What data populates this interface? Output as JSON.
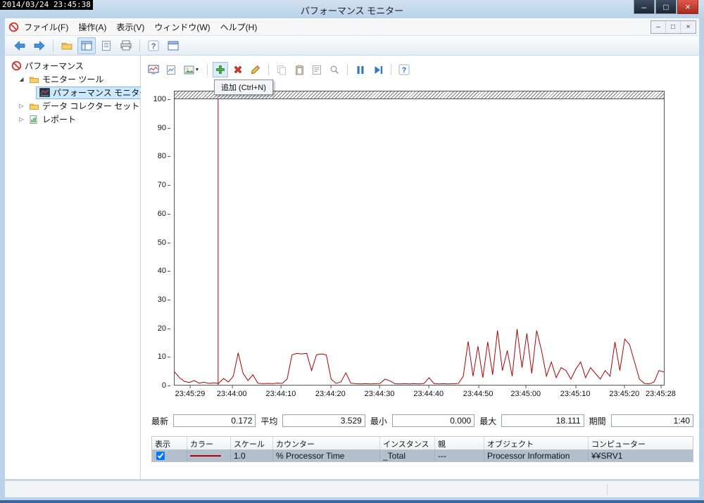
{
  "overlay": {
    "timestamp": "2014/03/24 23:45:38"
  },
  "window": {
    "title": "パフォーマンス モニター",
    "controls": {
      "minimize": "–",
      "maximize": "□",
      "close": "×"
    },
    "child_controls": [
      "–",
      "□",
      "×"
    ]
  },
  "menubar": {
    "items": [
      {
        "label": "ファイル(F)"
      },
      {
        "label": "操作(A)"
      },
      {
        "label": "表示(V)"
      },
      {
        "label": "ウィンドウ(W)"
      },
      {
        "label": "ヘルプ(H)"
      }
    ]
  },
  "toolbar": {
    "buttons": [
      "back",
      "forward",
      "export",
      "show-hide-console-tree",
      "list",
      "print",
      "help",
      "new-window"
    ]
  },
  "tree": {
    "items": [
      {
        "label": "パフォーマンス"
      },
      {
        "label": "モニター ツール",
        "expanded": true
      },
      {
        "label": "パフォーマンス モニター",
        "selected": true
      },
      {
        "label": "データ コレクター セット",
        "expanded": false
      },
      {
        "label": "レポート",
        "expanded": false
      }
    ]
  },
  "pm_toolbar": {
    "buttons": [
      "view-current-activity",
      "view-log-data",
      "change-graph-type",
      "add",
      "delete",
      "highlight",
      "copy-properties",
      "paste-counter-list",
      "properties",
      "zoom",
      "freeze-display",
      "update-data",
      "help"
    ]
  },
  "tooltip": {
    "text": "追加 (Ctrl+N)"
  },
  "icons": {
    "help": "?",
    "caret": "▼",
    "expander_open": "◢",
    "expander_closed": "▷"
  },
  "chart_data": {
    "type": "line",
    "ylim": [
      0,
      100
    ],
    "grid": false,
    "y_ticks": [
      100,
      90,
      80,
      70,
      60,
      50,
      40,
      30,
      20,
      10,
      0
    ],
    "x_ticks": [
      "23:45:29",
      "23:44:00",
      "23:44:10",
      "23:44:20",
      "23:44:30",
      "23:44:40",
      "23:44:50",
      "23:45:00",
      "23:45:10",
      "23:45:20",
      "23:45:28"
    ],
    "x_tick_positions": [
      3.3,
      11.8,
      21.8,
      31.9,
      41.9,
      51.9,
      62.0,
      71.7,
      81.8,
      91.8,
      99.2
    ],
    "cursor_position": 8.9,
    "cursor_color": "#b00000",
    "series": [
      {
        "name": "% Processor Time",
        "color": "#b00000",
        "values": [
          4.5,
          2.5,
          1.2,
          0.8,
          1.5,
          0.6,
          0.9,
          0.5,
          0.7,
          0.5,
          2.2,
          1.0,
          3.0,
          11.2,
          4.0,
          1.5,
          3.5,
          0.6,
          0.4,
          0.5,
          0.4,
          0.6,
          0.5,
          2.0,
          10.5,
          11.0,
          10.8,
          11.0,
          5.0,
          10.5,
          10.8,
          10.5,
          2.0,
          0.5,
          1.0,
          4.2,
          0.6,
          0.4,
          0.3,
          0.4,
          0.3,
          0.4,
          0.5,
          2.0,
          1.4,
          0.4,
          0.3,
          0.4,
          0.3,
          0.4,
          0.3,
          0.5,
          2.5,
          0.5,
          0.3,
          0.4,
          0.3,
          0.4,
          0.5,
          3.0,
          15.2,
          3.0,
          13.5,
          2.5,
          15.0,
          3.5,
          19.0,
          5.0,
          12.0,
          3.0,
          19.5,
          6.0,
          18.0,
          4.0,
          19.0,
          12.0,
          3.0,
          8.0,
          2.5,
          6.0,
          5.0,
          2.0,
          5.5,
          8.0,
          2.5,
          6.0,
          4.0,
          2.0,
          5.0,
          3.0,
          15.0,
          5.0,
          16.0,
          14.0,
          8.0,
          2.0,
          0.5,
          0.3,
          1.0,
          5.0,
          4.5
        ]
      }
    ]
  },
  "stats": {
    "items": [
      {
        "label": "最新",
        "value": "0.172"
      },
      {
        "label": "平均",
        "value": "3.529"
      },
      {
        "label": "最小",
        "value": "0.000"
      },
      {
        "label": "最大",
        "value": "18.111"
      },
      {
        "label": "期間",
        "value": "1:40"
      }
    ]
  },
  "counters": {
    "headers": [
      "表示",
      "カラー",
      "スケール",
      "カウンター",
      "インスタンス",
      "親",
      "オブジェクト",
      "コンピューター"
    ],
    "rows": [
      {
        "show": true,
        "color": "#b00000",
        "scale": "1.0",
        "counter": "% Processor Time",
        "instance": "_Total",
        "parent": "---",
        "object": "Processor Information",
        "computer": "¥¥SRV1"
      }
    ]
  }
}
